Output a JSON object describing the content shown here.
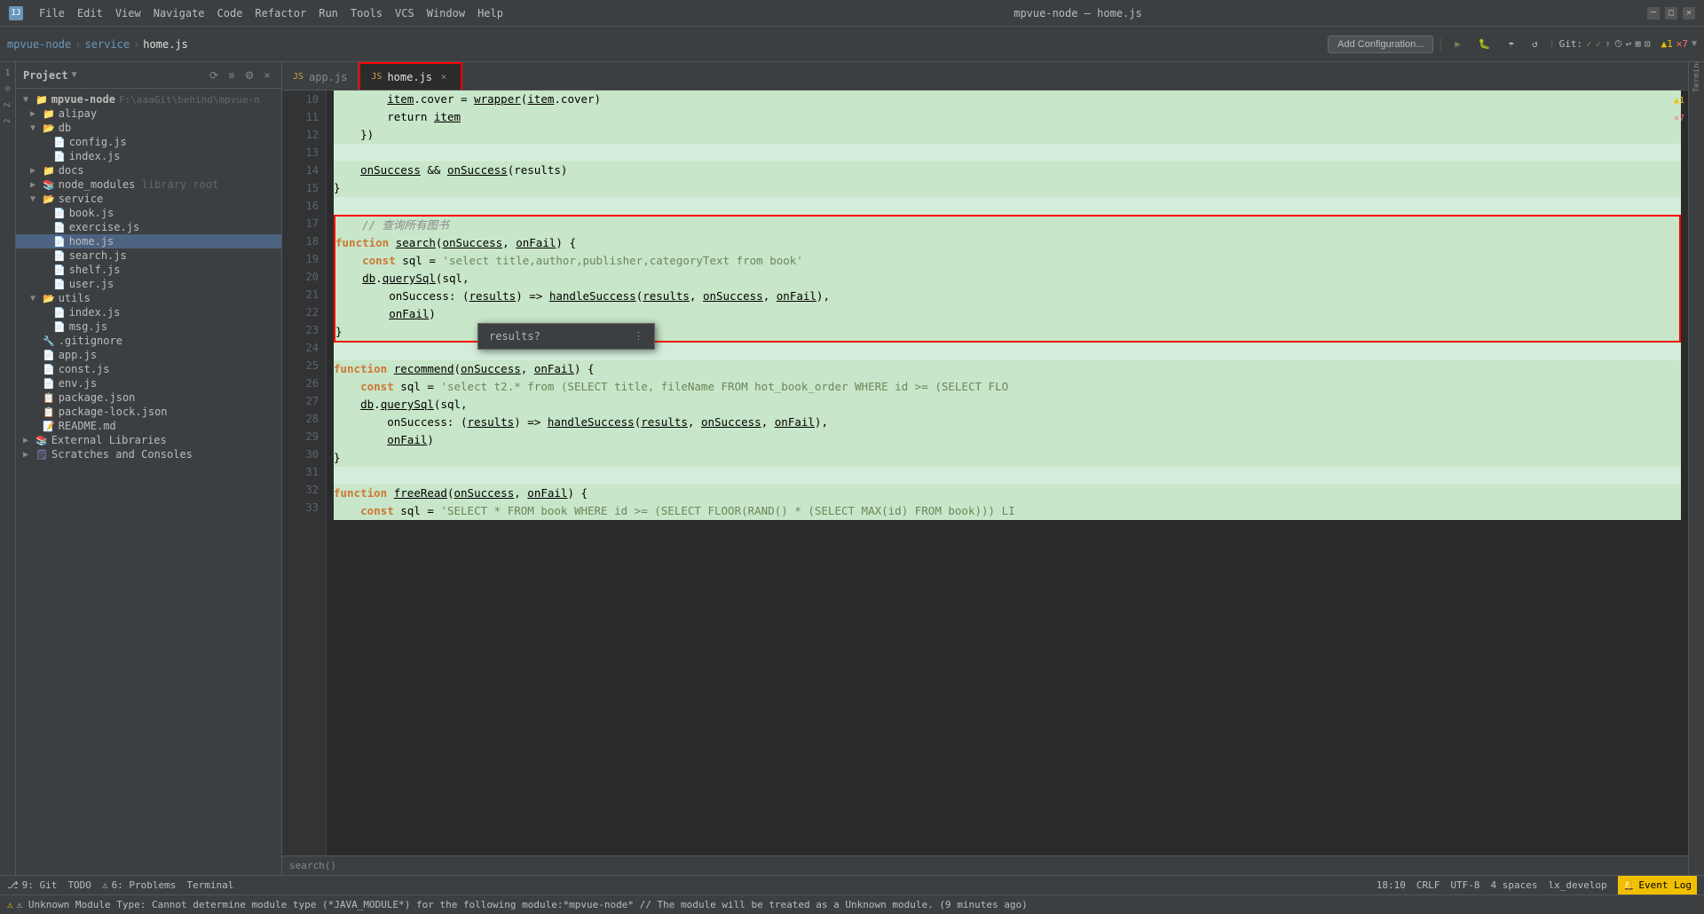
{
  "titleBar": {
    "appName": "mpvue-node",
    "separator1": "›",
    "service": "service",
    "separator2": "›",
    "filename": "home.js",
    "windowTitle": "mpvue-node – home.js",
    "menuItems": [
      "File",
      "Edit",
      "View",
      "Navigate",
      "Code",
      "Refactor",
      "Run",
      "Tools",
      "VCS",
      "Window",
      "Help"
    ]
  },
  "toolbar": {
    "breadcrumb": [
      "mpvue-node",
      "service",
      "home.js"
    ],
    "addConfig": "Add Configuration...",
    "gitLabel": "Git:",
    "warningCount": "▲1",
    "errorCount": "✕7"
  },
  "projectPanel": {
    "title": "Project",
    "rootNode": "mpvue-node",
    "rootPath": "F:\\aaaGit\\behind\\mpvue-n",
    "items": [
      {
        "level": 1,
        "type": "folder",
        "name": "alipay",
        "expanded": false
      },
      {
        "level": 1,
        "type": "folder",
        "name": "db",
        "expanded": true
      },
      {
        "level": 2,
        "type": "js",
        "name": "config.js"
      },
      {
        "level": 2,
        "type": "js",
        "name": "index.js"
      },
      {
        "level": 1,
        "type": "folder",
        "name": "docs",
        "expanded": false
      },
      {
        "level": 1,
        "type": "folder-lib",
        "name": "node_modules",
        "suffix": "library root",
        "expanded": false
      },
      {
        "level": 1,
        "type": "folder",
        "name": "service",
        "expanded": true
      },
      {
        "level": 2,
        "type": "js",
        "name": "book.js"
      },
      {
        "level": 2,
        "type": "js",
        "name": "exercise.js"
      },
      {
        "level": 2,
        "type": "js",
        "name": "home.js",
        "selected": true
      },
      {
        "level": 2,
        "type": "js",
        "name": "search.js"
      },
      {
        "level": 2,
        "type": "js",
        "name": "shelf.js"
      },
      {
        "level": 2,
        "type": "js",
        "name": "user.js"
      },
      {
        "level": 1,
        "type": "folder",
        "name": "utils",
        "expanded": true
      },
      {
        "level": 2,
        "type": "js",
        "name": "index.js"
      },
      {
        "level": 2,
        "type": "js",
        "name": "msg.js"
      },
      {
        "level": 1,
        "type": "git",
        "name": ".gitignore"
      },
      {
        "level": 1,
        "type": "js",
        "name": "app.js"
      },
      {
        "level": 1,
        "type": "js",
        "name": "const.js"
      },
      {
        "level": 1,
        "type": "js",
        "name": "env.js"
      },
      {
        "level": 1,
        "type": "json",
        "name": "package.json"
      },
      {
        "level": 1,
        "type": "json",
        "name": "package-lock.json"
      },
      {
        "level": 1,
        "type": "md",
        "name": "README.md"
      },
      {
        "level": 0,
        "type": "lib",
        "name": "External Libraries",
        "expanded": false
      },
      {
        "level": 0,
        "type": "scratch",
        "name": "Scratches and Consoles",
        "expanded": false
      }
    ]
  },
  "tabs": [
    {
      "label": "app.js",
      "active": false,
      "icon": "js"
    },
    {
      "label": "home.js",
      "active": true,
      "icon": "js",
      "highlighted": true
    }
  ],
  "codeLines": [
    {
      "num": 10,
      "content": "        item.cover = wrapper(item.cover)",
      "bg": "green"
    },
    {
      "num": 11,
      "content": "        return item",
      "bg": "green"
    },
    {
      "num": 12,
      "content": "    })",
      "bg": "green"
    },
    {
      "num": 13,
      "content": "",
      "bg": "normal"
    },
    {
      "num": 14,
      "content": "    onSuccess && onSuccess(results)",
      "bg": "green"
    },
    {
      "num": 15,
      "content": "}",
      "bg": "green"
    },
    {
      "num": 16,
      "content": "",
      "bg": "normal"
    },
    {
      "num": 17,
      "content": "    // 查询所有图书",
      "bg": "redbox"
    },
    {
      "num": 18,
      "content": "function search(onSuccess, onFail) {",
      "bg": "redbox"
    },
    {
      "num": 19,
      "content": "    const sql = 'select title,author,publisher,categoryText from book'",
      "bg": "redbox"
    },
    {
      "num": 20,
      "content": "    db.querySql(sql,",
      "bg": "redbox"
    },
    {
      "num": 21,
      "content": "        onSuccess: (results) => handleSuccess(results, onSuccess, onFail),",
      "bg": "redbox"
    },
    {
      "num": 22,
      "content": "        onFail)",
      "bg": "redbox-autocomplete"
    },
    {
      "num": 23,
      "content": "}",
      "bg": "redbox"
    },
    {
      "num": 24,
      "content": "",
      "bg": "normal"
    },
    {
      "num": 25,
      "content": "function recommend(onSuccess, onFail) {",
      "bg": "green"
    },
    {
      "num": 26,
      "content": "    const sql = 'select t2.* from (SELECT title, fileName FROM hot_book_order WHERE id >= (SELECT FLO",
      "bg": "green"
    },
    {
      "num": 27,
      "content": "    db.querySql(sql,",
      "bg": "green"
    },
    {
      "num": 28,
      "content": "        onSuccess: (results) => handleSuccess(results, onSuccess, onFail),",
      "bg": "green"
    },
    {
      "num": 29,
      "content": "        onFail)",
      "bg": "green"
    },
    {
      "num": 30,
      "content": "}",
      "bg": "green"
    },
    {
      "num": 31,
      "content": "",
      "bg": "normal"
    },
    {
      "num": 32,
      "content": "function freeRead(onSuccess, onFail) {",
      "bg": "green"
    },
    {
      "num": 33,
      "content": "    const sql = 'SELECT * FROM book WHERE id >= (SELECT FLOOR(RAND() * (SELECT MAX(id) FROM book))) LI",
      "bg": "green"
    }
  ],
  "autocomplete": {
    "text": "results?",
    "moreIcon": "⋮",
    "visible": true
  },
  "statusBar": {
    "git": "9: Git",
    "todo": "TODO",
    "problems": "6: Problems",
    "terminal": "Terminal",
    "warningText": "⚠ Unknown Module Type: Cannot determine module type (*JAVA_MODULE*) for the following module:*mpvue-node* // The module will be treated as a Unknown module. (9 minutes ago)",
    "position": "18:10",
    "lineEnding": "CRLF",
    "encoding": "UTF-8",
    "indent": "4 spaces",
    "branch": "lx_develop",
    "eventLog": "Event Log",
    "warningCount": "▲1",
    "errorCount": "✕7"
  },
  "rightGutter": {
    "warningIndicator": "▲1 ✕7"
  }
}
